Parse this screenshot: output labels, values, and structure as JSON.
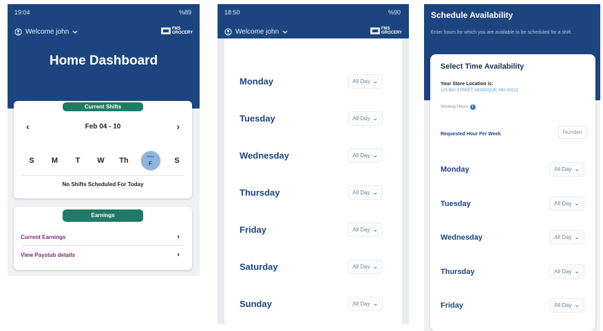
{
  "screen1": {
    "status_time": "19:04",
    "status_battery": "%89",
    "welcome": "Welcome john",
    "logo_line1": "FMS",
    "logo_line2": "GROCERY",
    "title": "Home Dashboard",
    "shifts_pill": "Current Shifts",
    "week_label": "Feb 04 - 10",
    "days": [
      "S",
      "M",
      "T",
      "W",
      "Th",
      "F",
      "S"
    ],
    "today_label": "Today",
    "no_shifts": "No Shifts Scheduled For Today",
    "earnings_pill": "Earnings",
    "earnings_items": [
      "Current Earnings",
      "View Paystub details"
    ]
  },
  "screen2": {
    "status_time": "18:50",
    "status_battery": "%90",
    "welcome": "Welcome john",
    "logo_line1": "FMS",
    "logo_line2": "GROCERY",
    "days": [
      {
        "name": "Monday",
        "value": "All Day"
      },
      {
        "name": "Tuesday",
        "value": "All Day"
      },
      {
        "name": "Wednesday",
        "value": "All Day"
      },
      {
        "name": "Thursday",
        "value": "All Day"
      },
      {
        "name": "Friday",
        "value": "All Day"
      },
      {
        "name": "Saturday",
        "value": "All Day"
      },
      {
        "name": "Sunday",
        "value": "All Day"
      }
    ]
  },
  "screen3": {
    "title": "Schedule Availability",
    "subtitle": "Enter hours for which you are available to be scheduled for a shift.",
    "card_title": "Select Time Availability",
    "location_label": "Your Store Location is:",
    "location_value": "123 BIG STREET, MODOQUE, MO 63122",
    "working_hours": "Working Hours",
    "requested_label": "Requested Hour Per Week",
    "number_placeholder": "Number",
    "days": [
      {
        "name": "Monday",
        "value": "All Day"
      },
      {
        "name": "Tuesday",
        "value": "All Day"
      },
      {
        "name": "Wednesday",
        "value": "All Day"
      },
      {
        "name": "Thursday",
        "value": "All Day"
      },
      {
        "name": "Friday",
        "value": "All Day"
      }
    ]
  },
  "colors": {
    "navy": "#1c4580",
    "teal": "#1f7a67",
    "purple_link": "#7a2a7a",
    "today_circle": "#8fb4de"
  },
  "icons": {
    "user": "user-circle-icon",
    "chevron_down": "chevron-down-icon",
    "chevron_left": "chevron-left-icon",
    "chevron_right": "chevron-right-icon",
    "info": "info-icon"
  }
}
